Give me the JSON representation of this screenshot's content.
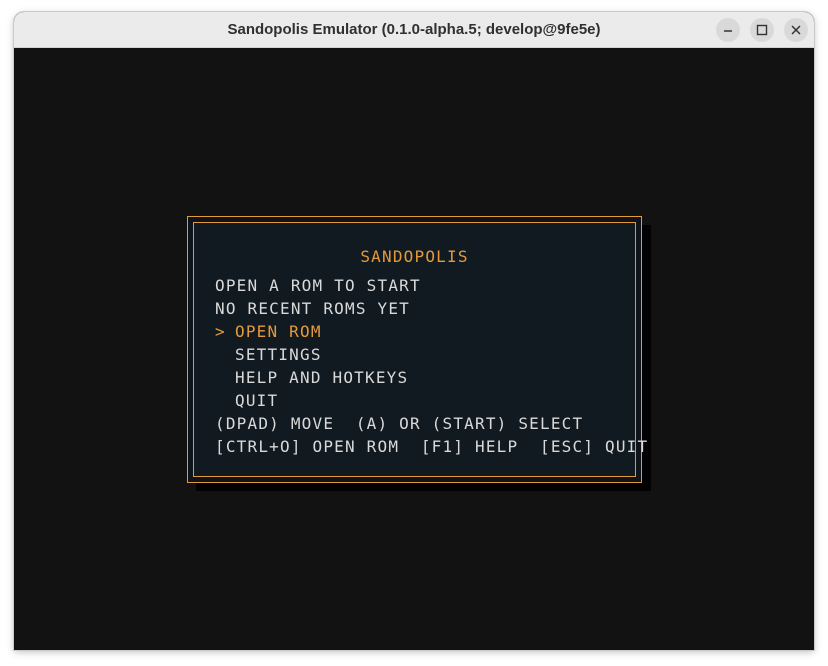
{
  "window": {
    "title": "Sandopolis Emulator (0.1.0-alpha.5; develop@9fe5e)",
    "controls": [
      "minimize-icon",
      "maximize-icon",
      "close-icon"
    ]
  },
  "menu": {
    "heading": "SANDOPOLIS",
    "status_lines": [
      "OPEN A ROM TO START",
      "NO RECENT ROMS YET"
    ],
    "cursor": ">",
    "items": [
      {
        "label": "OPEN ROM",
        "selected": true
      },
      {
        "label": "SETTINGS",
        "selected": false
      },
      {
        "label": "HELP AND HOTKEYS",
        "selected": false
      },
      {
        "label": "QUIT",
        "selected": false
      }
    ],
    "hints": [
      "(DPAD) MOVE  (A) OR (START) SELECT",
      "[CTRL+O] OPEN ROM  [F1] HELP  [ESC] QUIT"
    ]
  },
  "colors": {
    "accent": "#e59a3a",
    "background": "#121212",
    "panel": "#121a21",
    "text": "#d9d9d9"
  }
}
